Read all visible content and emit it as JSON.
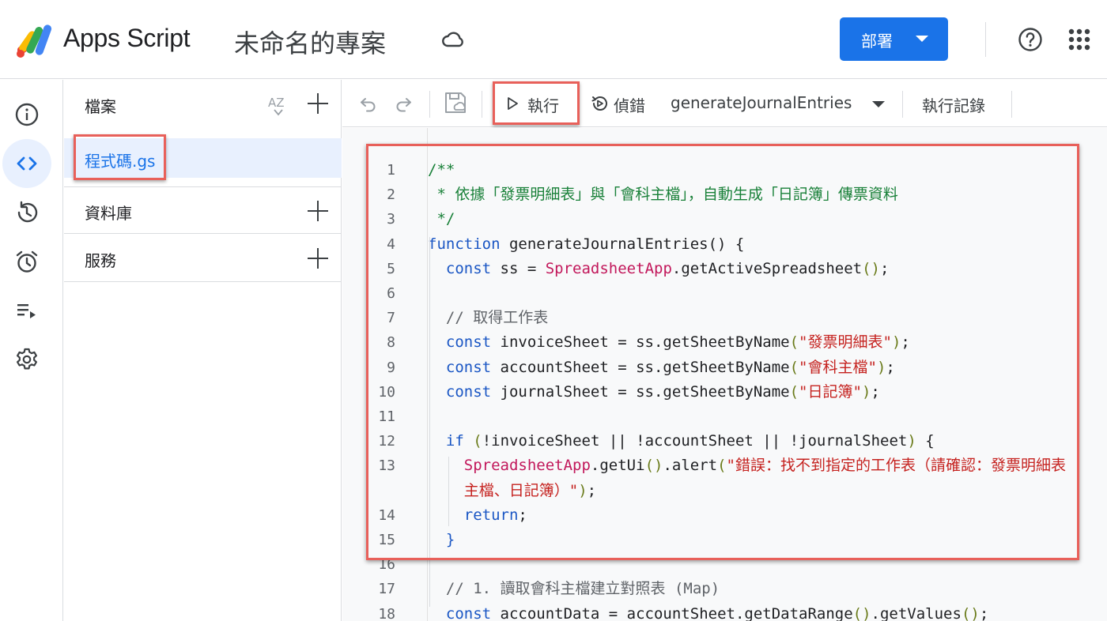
{
  "header": {
    "app_name": "Apps Script",
    "project_name": "未命名的專案",
    "deploy_label": "部署",
    "accent_color": "#1a73e8"
  },
  "rail": {
    "items": [
      {
        "icon": "info-icon",
        "name": "overview"
      },
      {
        "icon": "code-icon",
        "name": "editor",
        "active": true
      },
      {
        "icon": "history-icon",
        "name": "project-history"
      },
      {
        "icon": "alarm-icon",
        "name": "triggers"
      },
      {
        "icon": "playlist-icon",
        "name": "executions"
      },
      {
        "icon": "gear-icon",
        "name": "project-settings"
      }
    ]
  },
  "files": {
    "header_label": "檔案",
    "sort_label": "AZ",
    "file_name": "程式碼.gs",
    "libraries_label": "資料庫",
    "services_label": "服務"
  },
  "toolbar": {
    "run_label": "執行",
    "debug_label": "偵錯",
    "function_name": "generateJournalEntries",
    "execution_log_label": "執行記錄"
  },
  "editor": {
    "lines": [
      {
        "n": "1",
        "tokens": [
          {
            "t": "/**",
            "c": "c-comment"
          }
        ]
      },
      {
        "n": "2",
        "tokens": [
          {
            "t": " * 依據「發票明細表」與「會科主檔」，自動生成「日記簿」傳票資料",
            "c": "c-comment"
          }
        ]
      },
      {
        "n": "3",
        "tokens": [
          {
            "t": " */",
            "c": "c-comment"
          }
        ]
      },
      {
        "n": "4",
        "tokens": [
          {
            "t": "function",
            "c": "c-kw"
          },
          {
            "t": " generateJournalEntries() {",
            "c": ""
          }
        ]
      },
      {
        "n": "5",
        "tokens": [
          {
            "t": "  ",
            "c": ""
          },
          {
            "t": "const",
            "c": "c-kw"
          },
          {
            "t": " ss = ",
            "c": ""
          },
          {
            "t": "SpreadsheetApp",
            "c": "c-cls"
          },
          {
            "t": ".getActiveSpreadsheet",
            "c": ""
          },
          {
            "t": "()",
            "c": "c-paren"
          },
          {
            "t": ";",
            "c": ""
          }
        ]
      },
      {
        "n": "6",
        "tokens": []
      },
      {
        "n": "7",
        "tokens": [
          {
            "t": "  // 取得工作表",
            "c": "c-gray"
          }
        ]
      },
      {
        "n": "8",
        "tokens": [
          {
            "t": "  ",
            "c": ""
          },
          {
            "t": "const",
            "c": "c-kw"
          },
          {
            "t": " invoiceSheet = ss.getSheetByName",
            "c": ""
          },
          {
            "t": "(",
            "c": "c-paren"
          },
          {
            "t": "\"發票明細表\"",
            "c": "c-str"
          },
          {
            "t": ")",
            "c": "c-paren"
          },
          {
            "t": ";",
            "c": ""
          }
        ]
      },
      {
        "n": "9",
        "tokens": [
          {
            "t": "  ",
            "c": ""
          },
          {
            "t": "const",
            "c": "c-kw"
          },
          {
            "t": " accountSheet = ss.getSheetByName",
            "c": ""
          },
          {
            "t": "(",
            "c": "c-paren"
          },
          {
            "t": "\"會科主檔\"",
            "c": "c-str"
          },
          {
            "t": ")",
            "c": "c-paren"
          },
          {
            "t": ";",
            "c": ""
          }
        ]
      },
      {
        "n": "10",
        "tokens": [
          {
            "t": "  ",
            "c": ""
          },
          {
            "t": "const",
            "c": "c-kw"
          },
          {
            "t": " journalSheet = ss.getSheetByName",
            "c": ""
          },
          {
            "t": "(",
            "c": "c-paren"
          },
          {
            "t": "\"日記簿\"",
            "c": "c-str"
          },
          {
            "t": ")",
            "c": "c-paren"
          },
          {
            "t": ";",
            "c": ""
          }
        ]
      },
      {
        "n": "11",
        "tokens": []
      },
      {
        "n": "12",
        "tokens": [
          {
            "t": "  ",
            "c": ""
          },
          {
            "t": "if",
            "c": "c-kw"
          },
          {
            "t": " ",
            "c": ""
          },
          {
            "t": "(",
            "c": "c-paren"
          },
          {
            "t": "!invoiceSheet || !accountSheet || !journalSheet",
            "c": ""
          },
          {
            "t": ")",
            "c": "c-paren"
          },
          {
            "t": " {",
            "c": ""
          }
        ]
      },
      {
        "n": "13",
        "tokens": [
          {
            "t": "    ",
            "c": ""
          },
          {
            "t": "SpreadsheetApp",
            "c": "c-cls"
          },
          {
            "t": ".getUi",
            "c": ""
          },
          {
            "t": "()",
            "c": "c-paren"
          },
          {
            "t": ".alert",
            "c": ""
          },
          {
            "t": "(",
            "c": "c-paren"
          },
          {
            "t": "\"錯誤：找不到指定的工作表（請確認：發票明細表",
            "c": "c-str"
          }
        ]
      },
      {
        "n": "",
        "tokens": [
          {
            "t": "    ",
            "c": ""
          },
          {
            "t": "主檔、日記簿）\"",
            "c": "c-str"
          },
          {
            "t": ")",
            "c": "c-paren"
          },
          {
            "t": ";",
            "c": ""
          }
        ]
      },
      {
        "n": "14",
        "tokens": [
          {
            "t": "    ",
            "c": ""
          },
          {
            "t": "return",
            "c": "c-kw"
          },
          {
            "t": ";",
            "c": ""
          }
        ]
      },
      {
        "n": "15",
        "tokens": [
          {
            "t": "  }",
            "c": "c-kw"
          }
        ]
      },
      {
        "n": "16",
        "tokens": []
      },
      {
        "n": "17",
        "tokens": [
          {
            "t": "  // 1. 讀取會科主檔建立對照表 (Map)",
            "c": "c-gray"
          }
        ]
      },
      {
        "n": "18",
        "tokens": [
          {
            "t": "  ",
            "c": ""
          },
          {
            "t": "const",
            "c": "c-kw"
          },
          {
            "t": " accountData = accountSheet.getDataRange",
            "c": ""
          },
          {
            "t": "()",
            "c": "c-paren"
          },
          {
            "t": ".getValues",
            "c": ""
          },
          {
            "t": "()",
            "c": "c-paren"
          },
          {
            "t": ";",
            "c": ""
          }
        ]
      }
    ]
  }
}
